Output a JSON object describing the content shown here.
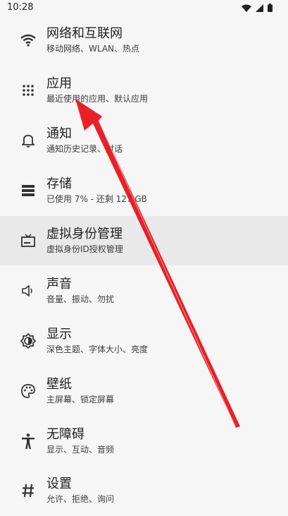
{
  "status_bar": {
    "time": "10:28",
    "icons": [
      "wifi-icon",
      "signal-icon",
      "battery-icon"
    ]
  },
  "settings": {
    "items": [
      {
        "title": "网络和互联网",
        "subtitle": "移动网络、WLAN、热点",
        "icon": "wifi-icon"
      },
      {
        "title": "应用",
        "subtitle": "最近使用的应用、默认应用",
        "icon": "apps-grid-icon"
      },
      {
        "title": "通知",
        "subtitle": "通知历史记录、对话",
        "icon": "bell-icon"
      },
      {
        "title": "存储",
        "subtitle": "已使用 7% - 还剩 127 GB",
        "icon": "storage-icon"
      },
      {
        "title": "虚拟身份管理",
        "subtitle": "虚拟身份ID授权管理",
        "icon": "tv-icon"
      },
      {
        "title": "声音",
        "subtitle": "音量、振动、勿扰",
        "icon": "volume-icon"
      },
      {
        "title": "显示",
        "subtitle": "深色主题、字体大小、亮度",
        "icon": "brightness-icon"
      },
      {
        "title": "壁纸",
        "subtitle": "主屏幕、锁定屏幕",
        "icon": "palette-icon"
      },
      {
        "title": "无障碍",
        "subtitle": "显示、互动、音频",
        "icon": "accessibility-icon"
      },
      {
        "title": "设置",
        "subtitle": "允许、拒绝、询问",
        "icon": "hash-icon"
      }
    ],
    "highlighted_index": 4
  },
  "colors": {
    "background": "#f6f6f6",
    "highlight": "#e9e9e9",
    "annotation_arrow": "#e8141c"
  }
}
